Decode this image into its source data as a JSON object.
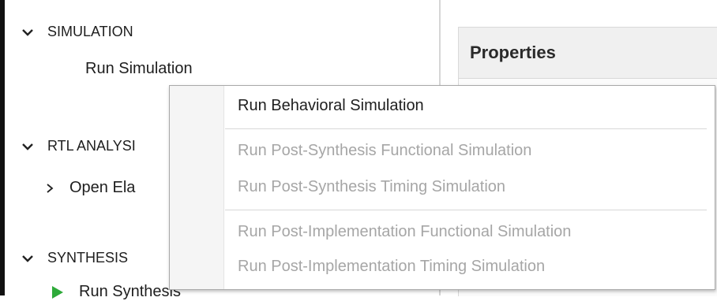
{
  "flow_navigator": {
    "simulation": {
      "header": "SIMULATION",
      "run_simulation": "Run Simulation"
    },
    "rtl_analysis": {
      "header": "RTL ANALYSI",
      "open_elaborated": "Open Ela"
    },
    "synthesis": {
      "header": "SYNTHESIS",
      "run_synthesis": "Run Synthesis"
    }
  },
  "properties": {
    "title": "Properties"
  },
  "context_menu": {
    "items": [
      {
        "label": "Run Behavioral Simulation",
        "enabled": true
      },
      {
        "label": "Run Post-Synthesis Functional Simulation",
        "enabled": false
      },
      {
        "label": "Run Post-Synthesis Timing Simulation",
        "enabled": false
      },
      {
        "label": "Run Post-Implementation Functional Simulation",
        "enabled": false
      },
      {
        "label": "Run Post-Implementation Timing Simulation",
        "enabled": false
      }
    ]
  },
  "colors": {
    "run_icon": "#2eaa3a",
    "disabled_text": "#a6a6a6"
  },
  "icons": {
    "expanded": "chevron-down-icon",
    "collapsed": "chevron-right-icon",
    "run": "play-icon"
  }
}
